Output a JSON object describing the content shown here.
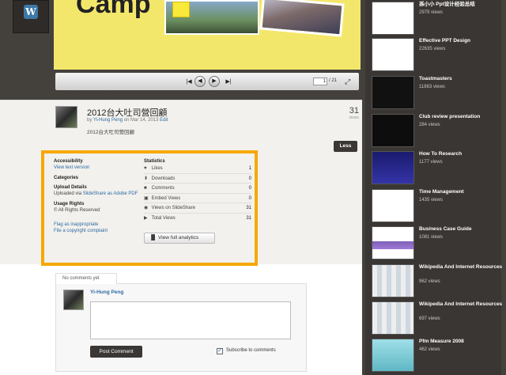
{
  "player": {
    "slide_word": "Camp",
    "page_current": "1",
    "page_total": "/ 21"
  },
  "deck": {
    "title": "2012台大吐司營回顧",
    "by_prefix": "by",
    "author": "Yi-Hung Peng",
    "date_text": "on Mar 14, 2013",
    "edit": "Edit",
    "description": "2012台大吐司營回顧",
    "views_count": "31",
    "views_label": "views",
    "less_label": "Less"
  },
  "details": {
    "accessibility_h": "Accessibility",
    "view_text": "View text version",
    "categories_h": "Categories",
    "upload_h": "Upload Details",
    "upload_prefix": "Uploaded via",
    "upload_link": "SlideShare as Adobe PDF",
    "usage_h": "Usage Rights",
    "usage_t": "© All Rights Reserved",
    "flag": "Flag as inappropriate",
    "copyright": "File a copyright complaint",
    "stats_h": "Statistics",
    "stats": [
      {
        "icon": "heart-icon",
        "label": "Likes",
        "value": "1"
      },
      {
        "icon": "download-icon",
        "label": "Downloads",
        "value": "0"
      },
      {
        "icon": "comment-icon",
        "label": "Comments",
        "value": "0"
      },
      {
        "icon": "embed-icon",
        "label": "Embed Views",
        "value": "0"
      },
      {
        "icon": "slideshare-icon",
        "label": "Views on SlideShare",
        "value": "31"
      },
      {
        "icon": "play-icon",
        "label": "Total Views",
        "value": "31"
      }
    ],
    "analytics_label": "View full analytics"
  },
  "comments": {
    "tab_label": "No comments yet",
    "user": "Yi-Hung Peng",
    "post_label": "Post Comment",
    "subscribe_label": "Subscribe to comments"
  },
  "related": [
    {
      "title": "孫小小 Ppt设计经验总结",
      "views": "2979 views"
    },
    {
      "title": "Effective PPT Design",
      "views": "22635 views"
    },
    {
      "title": "Toastmasters",
      "views": "11863 views"
    },
    {
      "title": "Club review presentation",
      "views": "284 views"
    },
    {
      "title": "How To Research",
      "views": "1177 views"
    },
    {
      "title": "Time Management",
      "views": "1435 views"
    },
    {
      "title": "Business Case Guide",
      "views": "1081 views"
    },
    {
      "title": "Wikipedia And Internet Resources",
      "views": "962 views"
    },
    {
      "title": "Wikipedia And Internet Resources",
      "views": "697 views"
    },
    {
      "title": "Pfm Measure 2008",
      "views": "462 views"
    }
  ],
  "colors": {
    "highlight": "#f6a800",
    "link": "#2e6aa4",
    "sidebar_bg": "#44403c"
  }
}
